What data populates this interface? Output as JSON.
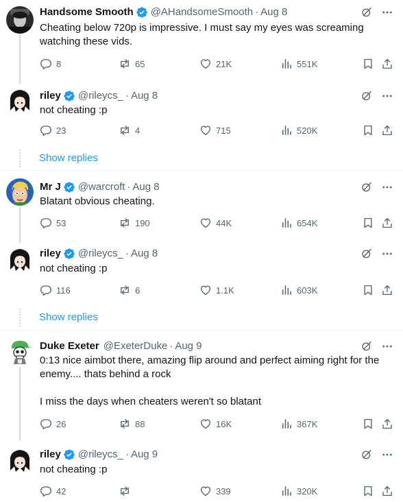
{
  "colors": {
    "accent": "#1d9bf0",
    "text": "#0f1419",
    "muted": "#536471",
    "thread": "#cfd9de"
  },
  "tweets": [
    {
      "name": "Handsome Smooth",
      "handle": "@AHandsomeSmooth",
      "date": "Aug 8",
      "text": "Cheating below 720p is impressive. I must say my eyes was screaming watching these vids.",
      "replies": "8",
      "retweets": "65",
      "likes": "21K",
      "views": "551K",
      "avatar": "handsome-smooth-avatar"
    },
    {
      "name": "riley",
      "handle": "@rileycs_",
      "date": "Aug 8",
      "text": "not cheating :p",
      "replies": "23",
      "retweets": "4",
      "likes": "715",
      "views": "520K",
      "avatar": "riley-avatar"
    },
    {
      "name": "Mr J",
      "handle": "@warcroft",
      "date": "Aug 8",
      "text": "Blatant obvious cheating.",
      "replies": "53",
      "retweets": "190",
      "likes": "44K",
      "views": "654K",
      "avatar": "mr-j-avatar"
    },
    {
      "name": "riley",
      "handle": "@rileycs_",
      "date": "Aug 8",
      "text": "not cheating :p",
      "replies": "116",
      "retweets": "6",
      "likes": "1.1K",
      "views": "603K",
      "avatar": "riley-avatar"
    },
    {
      "name": "Duke Exeter",
      "handle": "@ExeterDuke",
      "date": "Aug 9",
      "text": "0:13 nice aimbot there, amazing flip around and perfect aiming right for the enemy.... thats behind a rock\n\nI miss the days when cheaters weren't so blatant",
      "replies": "26",
      "retweets": "88",
      "likes": "16K",
      "views": "367K",
      "avatar": "duke-exeter-avatar"
    },
    {
      "name": "riley",
      "handle": "@rileycs_",
      "date": "Aug 9",
      "text": "not cheating :p",
      "replies": "42",
      "retweets": "",
      "likes": "339",
      "views": "320K",
      "avatar": "riley-avatar"
    }
  ],
  "show_replies": [
    "Show replies",
    "Show replies"
  ],
  "separator": "·"
}
